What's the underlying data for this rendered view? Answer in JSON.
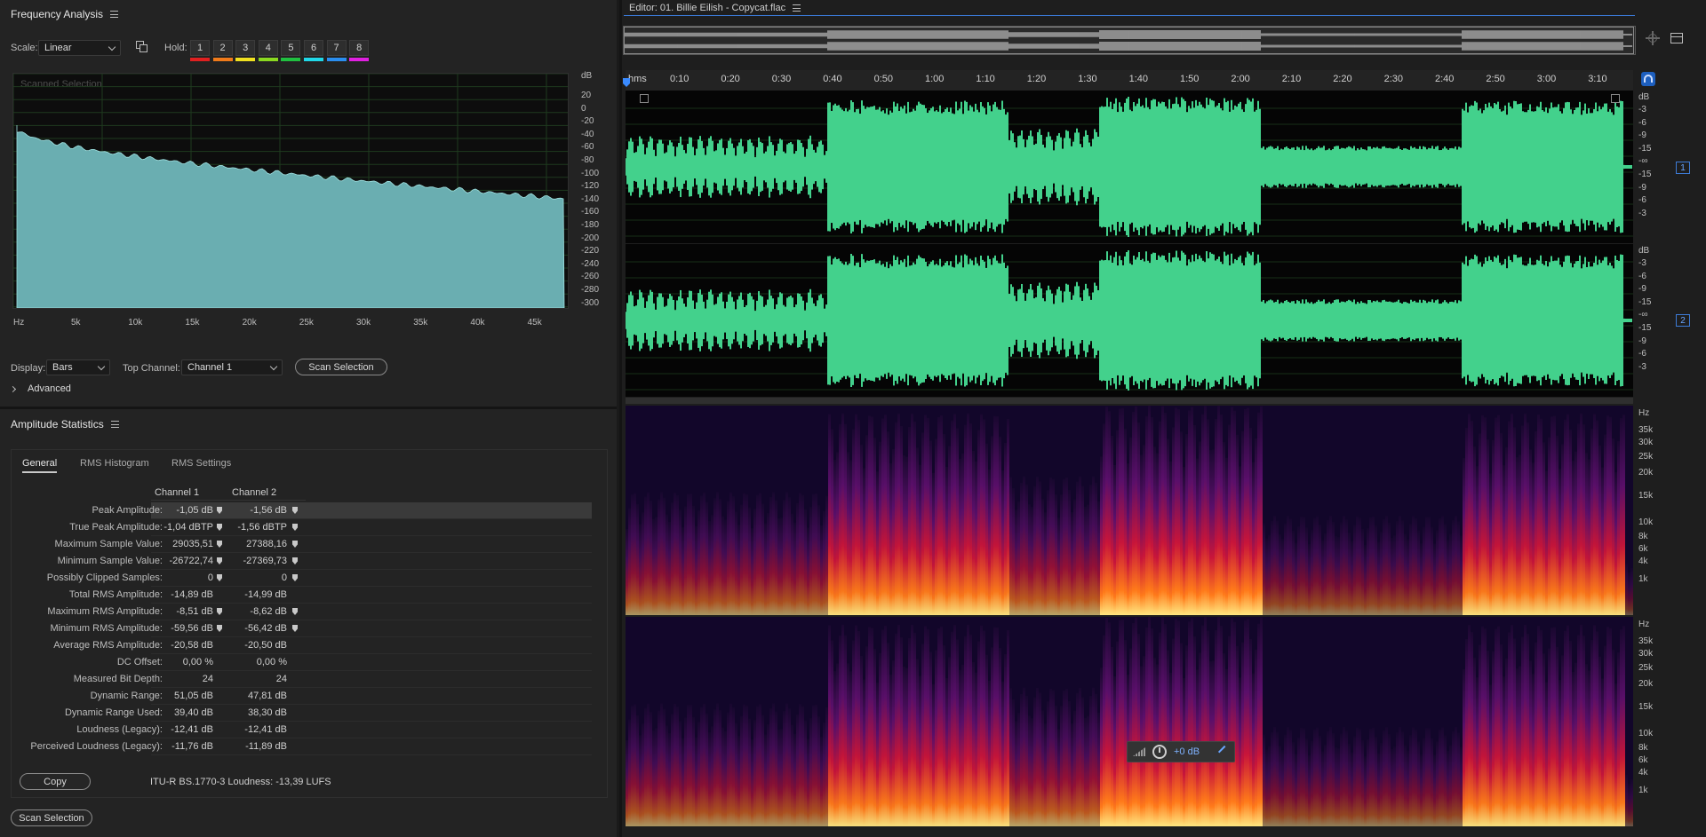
{
  "freq": {
    "title": "Frequency Analysis",
    "scale_label": "Scale:",
    "scale_value": "Linear",
    "hold_label": "Hold:",
    "hold_buttons": [
      {
        "n": "1",
        "color": "#e02020"
      },
      {
        "n": "2",
        "color": "#f07a1a"
      },
      {
        "n": "3",
        "color": "#f0e020"
      },
      {
        "n": "4",
        "color": "#8ad820"
      },
      {
        "n": "5",
        "color": "#20c040"
      },
      {
        "n": "6",
        "color": "#20d8e8"
      },
      {
        "n": "7",
        "color": "#2a8ef0"
      },
      {
        "n": "8",
        "color": "#e020e0"
      }
    ],
    "graph_label": "Scanned Selection",
    "db_unit": "dB",
    "db_ticks": [
      "20",
      "0",
      "-20",
      "-40",
      "-60",
      "-80",
      "-100",
      "-120",
      "-140",
      "-160",
      "-180",
      "-200",
      "-220",
      "-240",
      "-260",
      "-280",
      "-300"
    ],
    "hz_ticks": [
      "Hz",
      "5k",
      "10k",
      "15k",
      "20k",
      "25k",
      "30k",
      "35k",
      "40k",
      "45k"
    ],
    "display_label": "Display:",
    "display_value": "Bars",
    "top_channel_label": "Top Channel:",
    "top_channel_value": "Channel 1",
    "scan_button": "Scan Selection",
    "advanced_label": "Advanced"
  },
  "amp": {
    "title": "Amplitude Statistics",
    "tabs": [
      "General",
      "RMS Histogram",
      "RMS Settings"
    ],
    "col1": "Channel 1",
    "col2": "Channel 2",
    "rows": [
      {
        "name": "Peak Amplitude:",
        "c1": "-1,05 dB",
        "c2": "-1,56 dB",
        "m": true
      },
      {
        "name": "True Peak Amplitude:",
        "c1": "-1,04 dBTP",
        "c2": "-1,56 dBTP",
        "m": true
      },
      {
        "name": "Maximum Sample Value:",
        "c1": "29035,51",
        "c2": "27388,16",
        "m": true
      },
      {
        "name": "Minimum Sample Value:",
        "c1": "-26722,74",
        "c2": "-27369,73",
        "m": true
      },
      {
        "name": "Possibly Clipped Samples:",
        "c1": "0",
        "c2": "0",
        "m": true
      },
      {
        "name": "Total RMS Amplitude:",
        "c1": "-14,89 dB",
        "c2": "-14,99 dB",
        "m": false
      },
      {
        "name": "Maximum RMS Amplitude:",
        "c1": "-8,51 dB",
        "c2": "-8,62 dB",
        "m": true
      },
      {
        "name": "Minimum RMS Amplitude:",
        "c1": "-59,56 dB",
        "c2": "-56,42 dB",
        "m": true
      },
      {
        "name": "Average RMS Amplitude:",
        "c1": "-20,58 dB",
        "c2": "-20,50 dB",
        "m": false
      },
      {
        "name": "DC Offset:",
        "c1": "0,00 %",
        "c2": "0,00 %",
        "m": false
      },
      {
        "name": "Measured Bit Depth:",
        "c1": "24",
        "c2": "24",
        "m": false
      },
      {
        "name": "Dynamic Range:",
        "c1": "51,05 dB",
        "c2": "47,81 dB",
        "m": false
      },
      {
        "name": "Dynamic Range Used:",
        "c1": "39,40 dB",
        "c2": "38,30 dB",
        "m": false
      },
      {
        "name": "Loudness (Legacy):",
        "c1": "-12,41 dB",
        "c2": "-12,41 dB",
        "m": false
      },
      {
        "name": "Perceived Loudness (Legacy):",
        "c1": "-11,76 dB",
        "c2": "-11,89 dB",
        "m": false
      }
    ],
    "copy_button": "Copy",
    "lufs_text": "ITU-R BS.1770-3 Loudness: -13,39 LUFS",
    "scan_button": "Scan Selection"
  },
  "editor": {
    "title": "Editor: 01. Billie Eilish - Copycat.flac",
    "time_unit": "hms",
    "time_ticks": [
      "0:10",
      "0:20",
      "0:30",
      "0:40",
      "0:50",
      "1:00",
      "1:10",
      "1:20",
      "1:30",
      "1:40",
      "1:50",
      "2:00",
      "2:10",
      "2:20",
      "2:30",
      "2:40",
      "2:50",
      "3:00",
      "3:10"
    ],
    "db_unit": "dB",
    "db_ticks": [
      "-3",
      "-6",
      "-9",
      "-15",
      "-∞",
      "-15",
      "-9",
      "-6",
      "-3"
    ],
    "hz_unit": "Hz",
    "hz_ticks": [
      "35k",
      "30k",
      "25k",
      "20k",
      "15k",
      "10k",
      "8k",
      "6k",
      "4k",
      "1k"
    ],
    "channels": [
      "1",
      "2"
    ],
    "hud_value": "+0 dB",
    "wave_color": "#43d18c"
  }
}
